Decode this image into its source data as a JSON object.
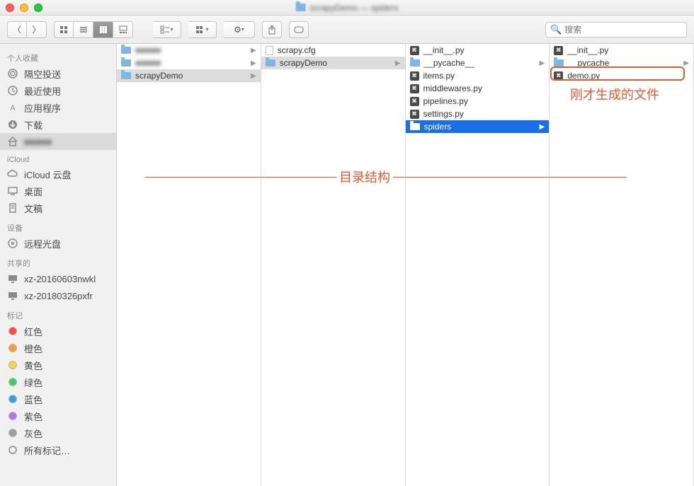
{
  "title_path_hint": "scrapyDemo — spiders",
  "search_placeholder": "搜索",
  "sidebar": {
    "sections": [
      {
        "header": "个人收藏",
        "items": [
          {
            "icon": "airdrop",
            "label": "隔空投送"
          },
          {
            "icon": "recent",
            "label": "最近使用"
          },
          {
            "icon": "apps",
            "label": "应用程序"
          },
          {
            "icon": "download",
            "label": "下载"
          },
          {
            "icon": "home",
            "label": "■■■■■",
            "selected": true,
            "blur": true
          }
        ]
      },
      {
        "header": "iCloud",
        "items": [
          {
            "icon": "cloud",
            "label": "iCloud 云盘"
          },
          {
            "icon": "desktop",
            "label": "桌面"
          },
          {
            "icon": "docs",
            "label": "文稿"
          }
        ]
      },
      {
        "header": "设备",
        "items": [
          {
            "icon": "disc",
            "label": "远程光盘"
          }
        ]
      },
      {
        "header": "共享的",
        "items": [
          {
            "icon": "monitor",
            "label": "xz-20160603nwkl"
          },
          {
            "icon": "monitor",
            "label": "xz-20180326pxfr"
          }
        ]
      },
      {
        "header": "标记",
        "items": [
          {
            "icon": "dot",
            "color": "#ff4b3e",
            "label": "红色"
          },
          {
            "icon": "dot",
            "color": "#ff9a2e",
            "label": "橙色"
          },
          {
            "icon": "dot",
            "color": "#ffd23e",
            "label": "黄色"
          },
          {
            "icon": "dot",
            "color": "#3bd25a",
            "label": "绿色"
          },
          {
            "icon": "dot",
            "color": "#2d9ff0",
            "label": "蓝色"
          },
          {
            "icon": "dot",
            "color": "#c16ff0",
            "label": "紫色"
          },
          {
            "icon": "dot",
            "color": "#9e9e9e",
            "label": "灰色"
          },
          {
            "icon": "alltags",
            "label": "所有标记…"
          }
        ]
      }
    ]
  },
  "columns": [
    [
      {
        "type": "folder",
        "label": "■■■■■",
        "arrow": true,
        "blur": true
      },
      {
        "type": "folder",
        "label": "■■■■■",
        "arrow": true,
        "blur": true
      },
      {
        "type": "folder",
        "label": "scrapyDemo",
        "arrow": true,
        "sel": "grey"
      }
    ],
    [
      {
        "type": "file",
        "label": "scrapy.cfg"
      },
      {
        "type": "folder",
        "label": "scrapyDemo",
        "arrow": true,
        "sel": "grey"
      }
    ],
    [
      {
        "type": "py",
        "label": "__init__.py"
      },
      {
        "type": "folder",
        "label": "__pycache__",
        "arrow": true
      },
      {
        "type": "py",
        "label": "items.py"
      },
      {
        "type": "py",
        "label": "middlewares.py"
      },
      {
        "type": "py",
        "label": "pipelines.py"
      },
      {
        "type": "py",
        "label": "settings.py"
      },
      {
        "type": "folder-blue",
        "label": "spiders",
        "arrow": true,
        "sel": "blue"
      }
    ],
    [
      {
        "type": "py",
        "label": "__init__.py"
      },
      {
        "type": "folder",
        "label": "__pycache__",
        "arrow": true
      },
      {
        "type": "py",
        "label": "demo.py",
        "highlight": true
      }
    ]
  ],
  "annotations": {
    "structure_label": "目录结构",
    "generated_label": "刚才生成的文件"
  }
}
